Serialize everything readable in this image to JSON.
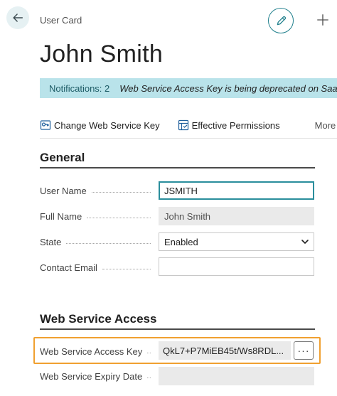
{
  "header": {
    "page_caption": "User Card",
    "record_title": "John Smith",
    "back_icon": "arrow-left-icon",
    "edit_icon": "pencil-icon",
    "new_icon": "plus-icon",
    "accent_color": "#1f7f8c"
  },
  "notification": {
    "count_label": "Notifications: 2",
    "message": "Web Service Access Key is being deprecated on SaaS",
    "background_color": "#b9e3ea"
  },
  "actions": {
    "change_key_label": "Change Web Service Key",
    "effective_permissions_label": "Effective Permissions",
    "more_label": "More options"
  },
  "general": {
    "title": "General",
    "user_name": {
      "label": "User Name",
      "value": "JSMITH"
    },
    "full_name": {
      "label": "Full Name",
      "value": "John Smith"
    },
    "state": {
      "label": "State",
      "value": "Enabled"
    },
    "contact_email": {
      "label": "Contact Email",
      "value": ""
    }
  },
  "web_service": {
    "title": "Web Service Access",
    "access_key": {
      "label": "Web Service Access Key",
      "value": "QkL7+P7MiEB45t/Ws8RDL...",
      "assist_label": "···"
    },
    "expiry_date": {
      "label": "Web Service Expiry Date",
      "value": ""
    },
    "highlight_color": "#f0a030"
  }
}
